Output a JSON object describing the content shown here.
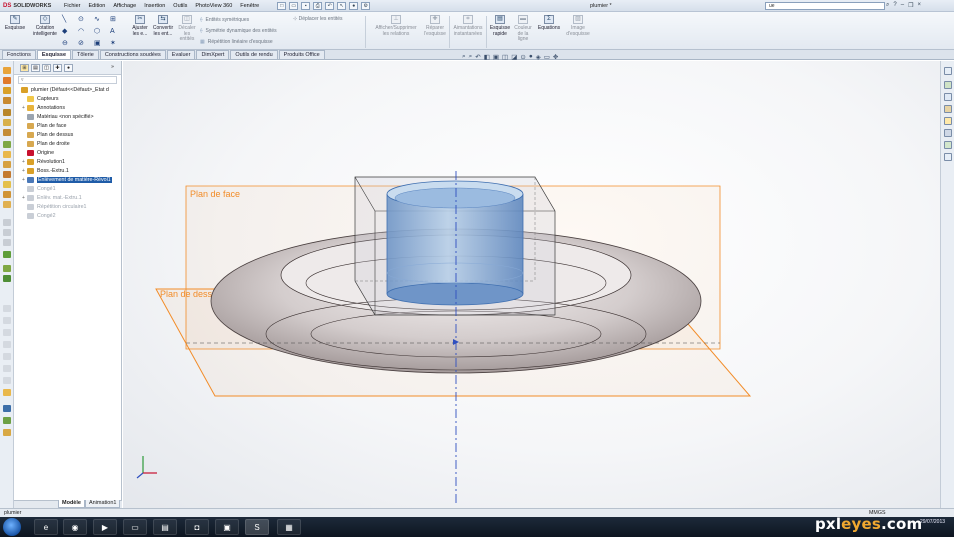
{
  "app": {
    "brand": "SOLIDWORKS",
    "brand_prefix": "DS",
    "document_title": "plumier *"
  },
  "menu": [
    "Fichier",
    "Edition",
    "Affichage",
    "Insertion",
    "Outils",
    "PhotoView 360",
    "Fenêtre"
  ],
  "search": {
    "value": "ue"
  },
  "command_manager": {
    "esquisse": "Esquisse",
    "cotation": "Cotation\nintelligente",
    "ajuster": "Ajuster\nles e...",
    "convertir": "Convertir\nles ent...",
    "decaler": "Décaler\nles\nentités",
    "entites_symetriques": "Entités symétriques",
    "symetrie_dynamique": "Symétrie dynamique des entités",
    "repetition_lineaire": "Répétition linéaire d'esquisse",
    "deplacer": "Déplacer les entités",
    "afficher_relations": "Afficher/Supprimer\nles relations",
    "reparer": "Réparer\nl'esquisse",
    "aimantations": "Aimantations\ninstantanées",
    "esquisse_rapide": "Esquisse\nrapide",
    "couleur_ligne": "Couleur\nde la\nligne",
    "equations": "Equations",
    "image_esquisse": "Image\nd'esquisse"
  },
  "tabs": [
    {
      "label": "Fonctions",
      "active": false
    },
    {
      "label": "Esquisse",
      "active": true
    },
    {
      "label": "Tôlerie",
      "active": false
    },
    {
      "label": "Constructions soudées",
      "active": false
    },
    {
      "label": "Evaluer",
      "active": false
    },
    {
      "label": "DimXpert",
      "active": false
    },
    {
      "label": "Outils de rendu",
      "active": false
    },
    {
      "label": "Produits Office",
      "active": false
    }
  ],
  "feature_tree": [
    {
      "label": "plumier  (Défaut<<Défaut>_Etat d",
      "indent": 0,
      "plus": "",
      "color": "#d9a028",
      "state": "normal"
    },
    {
      "label": "Capteurs",
      "indent": 1,
      "plus": "",
      "color": "#f1c84a",
      "state": "normal"
    },
    {
      "label": "Annotations",
      "indent": 1,
      "plus": "+",
      "color": "#e7b33b",
      "state": "normal"
    },
    {
      "label": "Matériau <non spécifié>",
      "indent": 1,
      "plus": "",
      "color": "#9aa4b0",
      "state": "normal"
    },
    {
      "label": "Plan de face",
      "indent": 1,
      "plus": "",
      "color": "#d7a850",
      "state": "normal"
    },
    {
      "label": "Plan de dessus",
      "indent": 1,
      "plus": "",
      "color": "#d7a850",
      "state": "normal"
    },
    {
      "label": "Plan de droite",
      "indent": 1,
      "plus": "",
      "color": "#d7a850",
      "state": "normal"
    },
    {
      "label": "Origine",
      "indent": 1,
      "plus": "",
      "color": "#c8102e",
      "state": "normal"
    },
    {
      "label": "Révolution1",
      "indent": 1,
      "plus": "+",
      "color": "#d9a028",
      "state": "normal"
    },
    {
      "label": "Boss.-Extru.1",
      "indent": 1,
      "plus": "+",
      "color": "#d9a028",
      "state": "normal"
    },
    {
      "label": "Enlèvement de matière-Révol1",
      "indent": 1,
      "plus": "+",
      "color": "#4a78b8",
      "state": "selected"
    },
    {
      "label": "Congé1",
      "indent": 1,
      "plus": "",
      "color": "#c9ced6",
      "state": "grey"
    },
    {
      "label": "Enlèv. mat.-Extru.1",
      "indent": 1,
      "plus": "+",
      "color": "#c9ced6",
      "state": "grey"
    },
    {
      "label": "Répétition circulaire1",
      "indent": 1,
      "plus": "",
      "color": "#c9ced6",
      "state": "grey"
    },
    {
      "label": "Congé2",
      "indent": 1,
      "plus": "",
      "color": "#c9ced6",
      "state": "grey"
    }
  ],
  "bottom_tabs": [
    {
      "label": "Modèle",
      "active": true
    },
    {
      "label": "Animation1",
      "active": false
    }
  ],
  "viewport": {
    "plane_front_label": "Plan de face",
    "plane_top_label": "Plan de dessus",
    "plane_color": "#f28c28",
    "selection_color": "#4a7fc4"
  },
  "status": {
    "left": "plumier",
    "units": "MMGS"
  },
  "taskbar": {
    "date": "29/07/2013"
  },
  "watermark": {
    "text": "pxl",
    "accent": "eyes",
    "suffix": ".com"
  }
}
